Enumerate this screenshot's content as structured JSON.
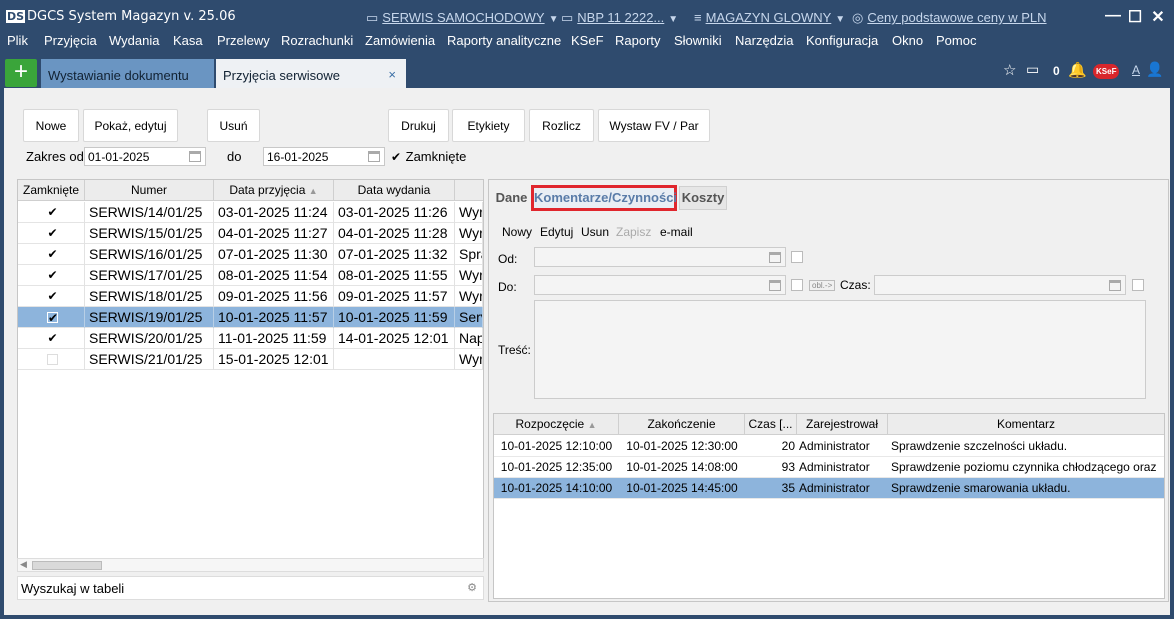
{
  "title": {
    "logo": "DS",
    "app": "DGCS System Magazyn v. 25.06",
    "service": "SERWIS SAMOCHODOWY",
    "rate": "NBP 11 2222...",
    "warehouse": "MAGAZYN GLOWNY",
    "prices": "Ceny podstawowe ceny w PLN"
  },
  "menu": [
    "Plik",
    "Przyjęcia",
    "Wydania",
    "Kasa",
    "Przelewy",
    "Rozrachunki",
    "Zamówienia",
    "Raporty analityczne",
    "KSeF",
    "Raporty",
    "Słowniki",
    "Narzędzia",
    "Konfiguracja",
    "Okno",
    "Pomoc"
  ],
  "tabs": {
    "add": "+",
    "tab1": "Wystawianie dokumentu",
    "tab2": "Przyjęcia serwisowe",
    "close": "×"
  },
  "topright": {
    "notif_count": "0",
    "ksef": "KSeF",
    "font": "A"
  },
  "toolbar": {
    "new": "Nowe",
    "show_edit": "Pokaż, edytuj",
    "delete": "Usuń",
    "print": "Drukuj",
    "labels": "Etykiety",
    "settle": "Rozlicz",
    "invoice": "Wystaw FV / Par"
  },
  "filter": {
    "from_label": "Zakres od",
    "from_value": "01-01-2025",
    "to_label": "do",
    "to_value": "16-01-2025",
    "closed_label": "Zamknięte",
    "closed_checked": true
  },
  "table": {
    "headers": [
      "Zamknięte",
      "Numer",
      "Data przyjęcia",
      "Data wydania"
    ],
    "rows": [
      {
        "closed": true,
        "number": "SERWIS/14/01/25",
        "received": "03-01-2025 11:24",
        "issued": "03-01-2025 11:26",
        "extra": "Wyr"
      },
      {
        "closed": true,
        "number": "SERWIS/15/01/25",
        "received": "04-01-2025 11:27",
        "issued": "04-01-2025 11:28",
        "extra": "Wyr"
      },
      {
        "closed": true,
        "number": "SERWIS/16/01/25",
        "received": "07-01-2025 11:30",
        "issued": "07-01-2025 11:32",
        "extra": "Spra"
      },
      {
        "closed": true,
        "number": "SERWIS/17/01/25",
        "received": "08-01-2025 11:54",
        "issued": "08-01-2025 11:55",
        "extra": "Wyr"
      },
      {
        "closed": true,
        "number": "SERWIS/18/01/25",
        "received": "09-01-2025 11:56",
        "issued": "09-01-2025 11:57",
        "extra": "Wyr"
      },
      {
        "closed": true,
        "number": "SERWIS/19/01/25",
        "received": "10-01-2025 11:57",
        "issued": "10-01-2025 11:59",
        "extra": "Serv"
      },
      {
        "closed": true,
        "number": "SERWIS/20/01/25",
        "received": "11-01-2025 11:59",
        "issued": "14-01-2025 12:01",
        "extra": "Nap"
      },
      {
        "closed": false,
        "number": "SERWIS/21/01/25",
        "received": "15-01-2025 12:01",
        "issued": "",
        "extra": "Wyr"
      }
    ],
    "selected_index": 5,
    "search_placeholder": "Wyszukaj w tabeli"
  },
  "detail": {
    "tabs": [
      "Dane",
      "Komentarze/Czynności",
      "Koszty"
    ],
    "actions": [
      "Nowy",
      "Edytuj",
      "Usun",
      "Zapisz",
      "e-mail"
    ],
    "from_label": "Od:",
    "to_label": "Do:",
    "time_label": "Czas:",
    "calc_label": "obl.->",
    "content_label": "Treść:",
    "grid_headers": [
      "Rozpoczęcie",
      "Zakończenie",
      "Czas [...",
      "Zarejestrował",
      "Komentarz"
    ],
    "grid_rows": [
      {
        "start": "10-01-2025 12:10:00",
        "end": "10-01-2025 12:30:00",
        "time": "20",
        "user": "Administrator",
        "comment": "Sprawdzenie szczelności układu."
      },
      {
        "start": "10-01-2025 12:35:00",
        "end": "10-01-2025 14:08:00",
        "time": "93",
        "user": "Administrator",
        "comment": "Sprawdzenie poziomu czynnika chłodzącego oraz"
      },
      {
        "start": "10-01-2025 14:10:00",
        "end": "10-01-2025 14:45:00",
        "time": "35",
        "user": "Administrator",
        "comment": "Sprawdzenie smarowania układu."
      }
    ]
  },
  "colors": {
    "frame": "#2f4b6e",
    "selection": "#8db4dc",
    "highlight": "#e0262d",
    "add_button": "#3aa53a"
  }
}
